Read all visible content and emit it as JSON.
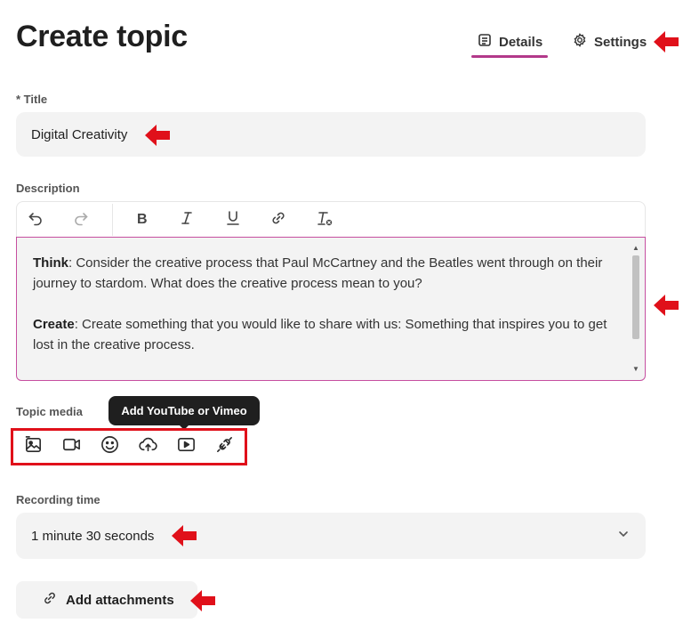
{
  "page": {
    "title": "Create topic"
  },
  "tabs": [
    {
      "label": "Details",
      "icon": "details-icon",
      "active": true
    },
    {
      "label": "Settings",
      "icon": "gear-icon",
      "active": false
    }
  ],
  "title_field": {
    "label": "* Title",
    "value": "Digital Creativity"
  },
  "description": {
    "label": "Description",
    "toolbar": [
      "undo-icon",
      "redo-icon",
      "bold-icon",
      "italic-icon",
      "underline-icon",
      "link-icon",
      "clear-format-icon"
    ],
    "paragraphs": [
      {
        "bold": "Think",
        "text": ": Consider the creative process that Paul McCartney and the Beatles went through on their journey to stardom. What does the creative process mean to you?"
      },
      {
        "bold": "Create",
        "text": ": Create something that you would like to share with us: Something that inspires you to get lost in the creative process."
      }
    ]
  },
  "topic_media": {
    "label": "Topic media",
    "tooltip": "Add YouTube or Vimeo",
    "buttons": [
      "image-icon",
      "video-camera-icon",
      "emoji-icon",
      "upload-cloud-icon",
      "play-video-icon",
      "link-plug-icon"
    ]
  },
  "recording_time": {
    "label": "Recording time",
    "value": "1 minute 30 seconds"
  },
  "attachments": {
    "label": "Add attachments",
    "icon": "link-icon"
  },
  "colors": {
    "accent": "#b3398a",
    "annotation_red": "#e0101a",
    "field_bg": "#f3f3f3"
  }
}
